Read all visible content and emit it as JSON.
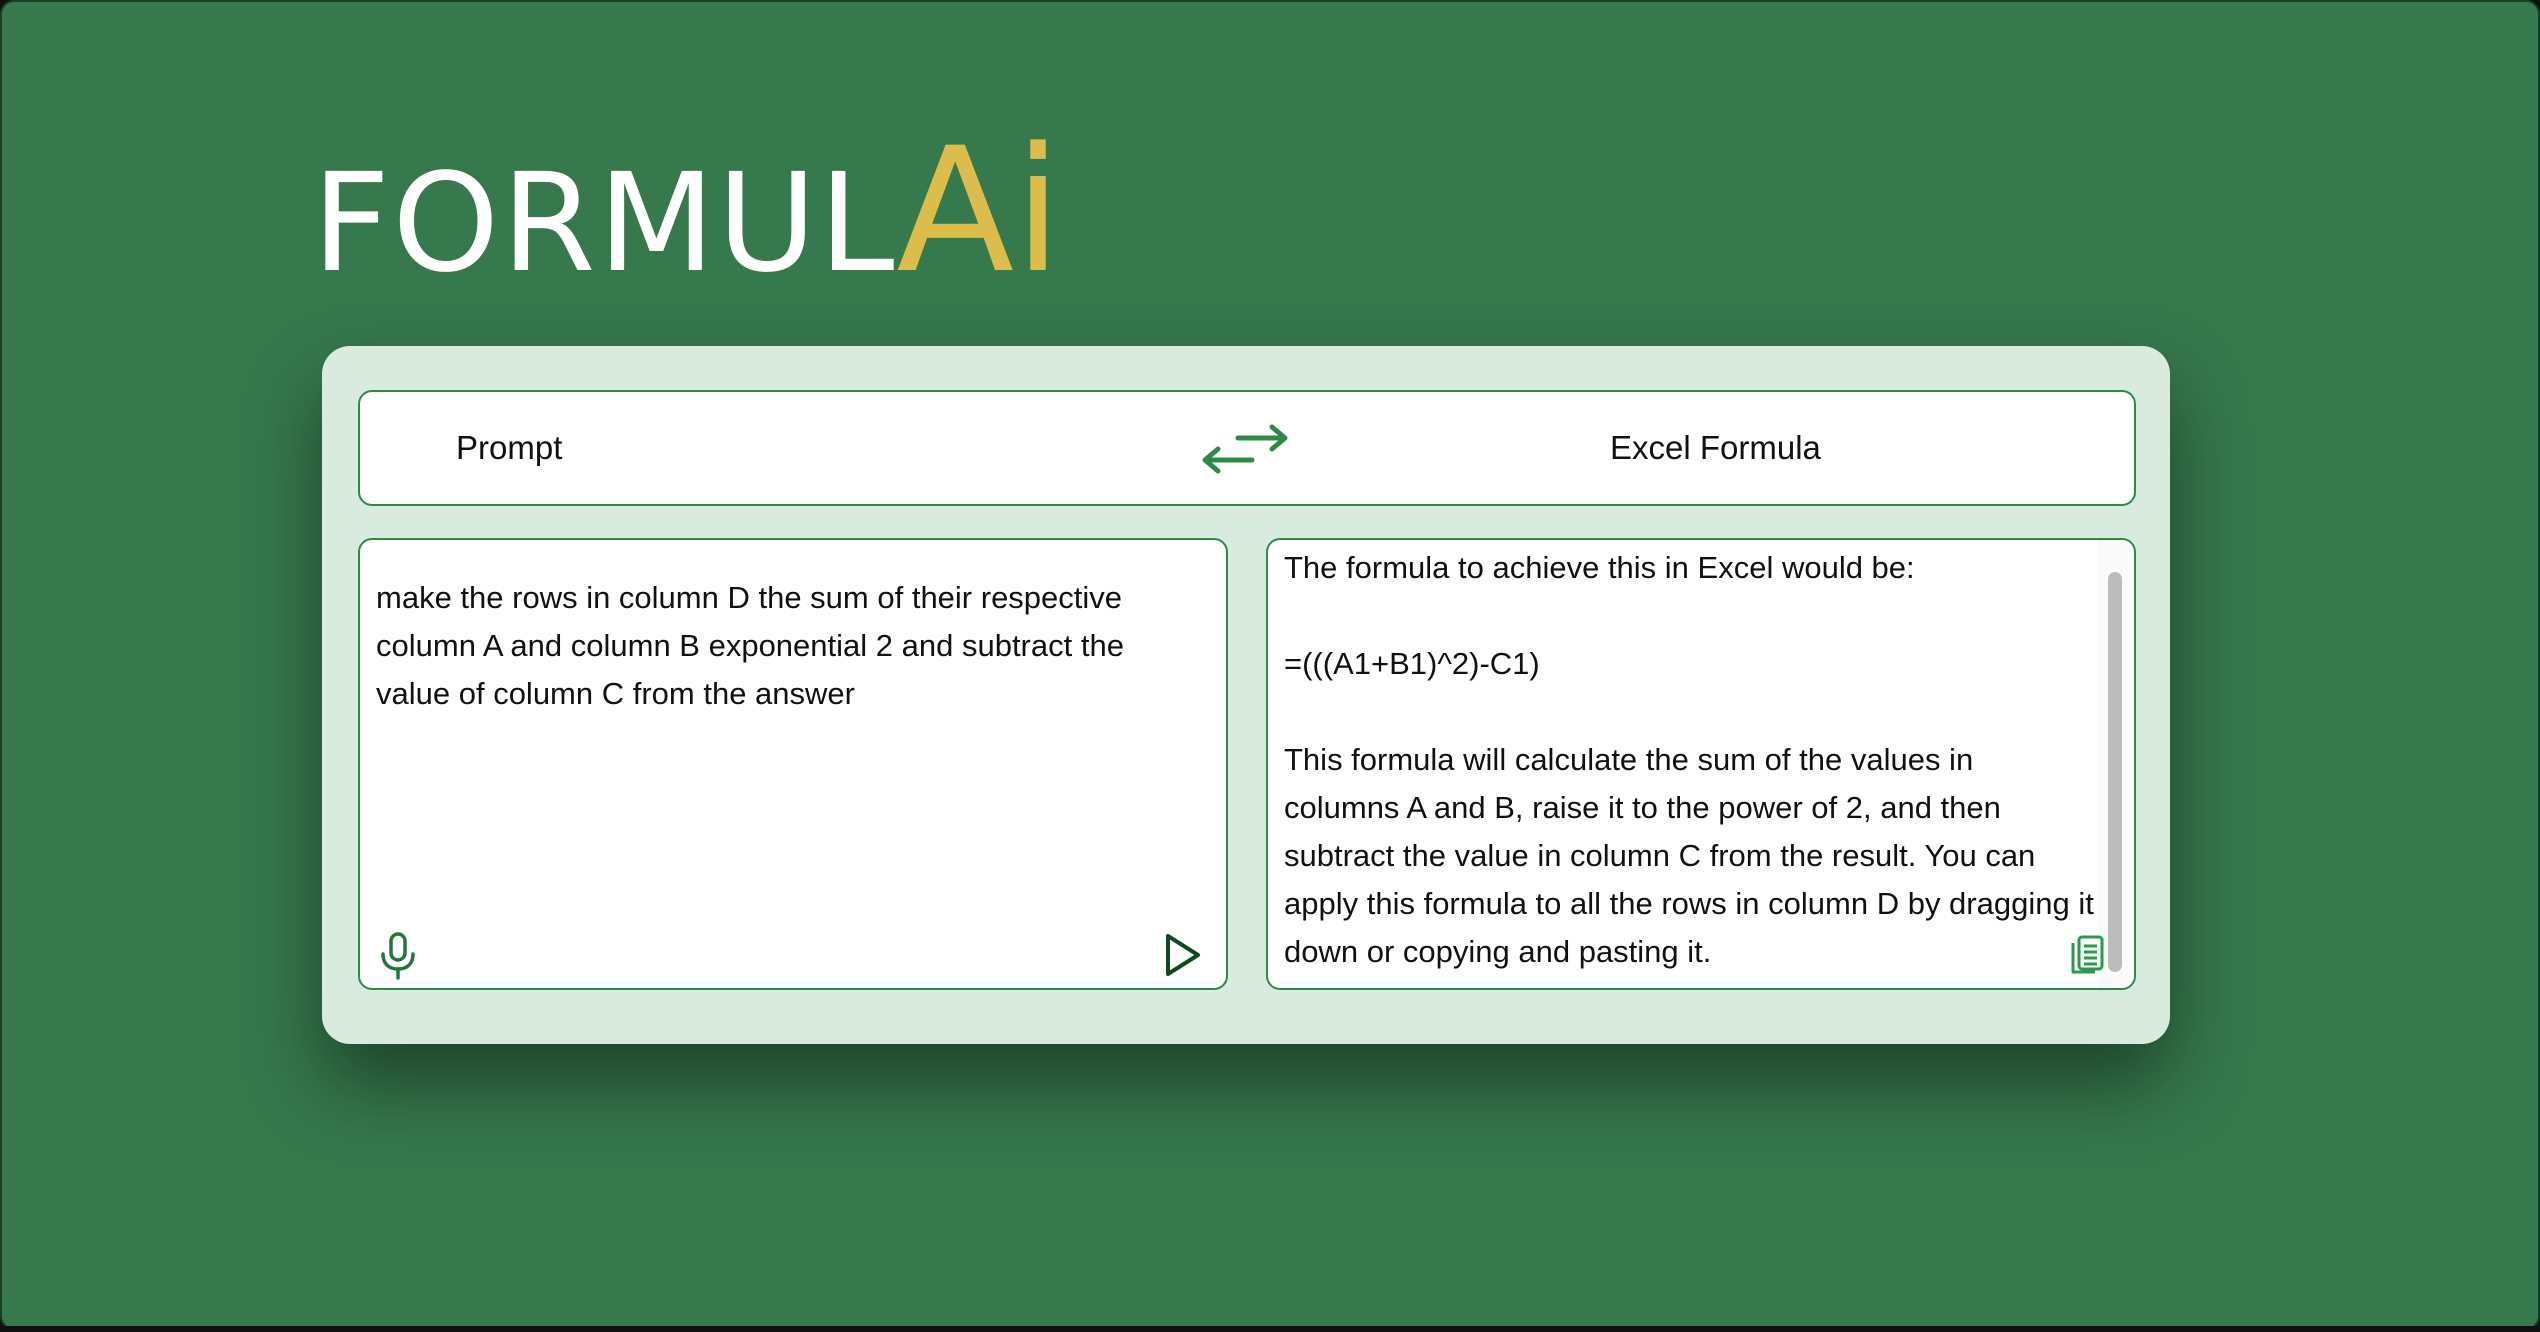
{
  "app": {
    "logo_base": "FORMUL",
    "logo_accent": "Ai"
  },
  "mode_bar": {
    "left_label": "Prompt",
    "right_label": "Excel Formula"
  },
  "prompt_panel": {
    "text": "make the rows in column D the sum of their respective column A and column B exponential 2 and subtract the value of column C from the answer"
  },
  "result_panel": {
    "text": "The formula to achieve this in Excel would be:\n\n=(((A1+B1)^2)-C1)\n\nThis formula will calculate the sum of the values in columns A and B, raise it to the power of 2, and then subtract the value in column C from the result. You can apply this formula to all the rows in column D by dragging it down or copying and pasting it."
  },
  "icons": {
    "swap": "swap-arrows-icon",
    "mic": "microphone-icon",
    "send": "send-icon",
    "copy": "copy-icon"
  },
  "colors": {
    "background": "#36794d",
    "accent": "#dcbc4a",
    "card": "#d9ebdf",
    "border": "#2f8a47"
  }
}
